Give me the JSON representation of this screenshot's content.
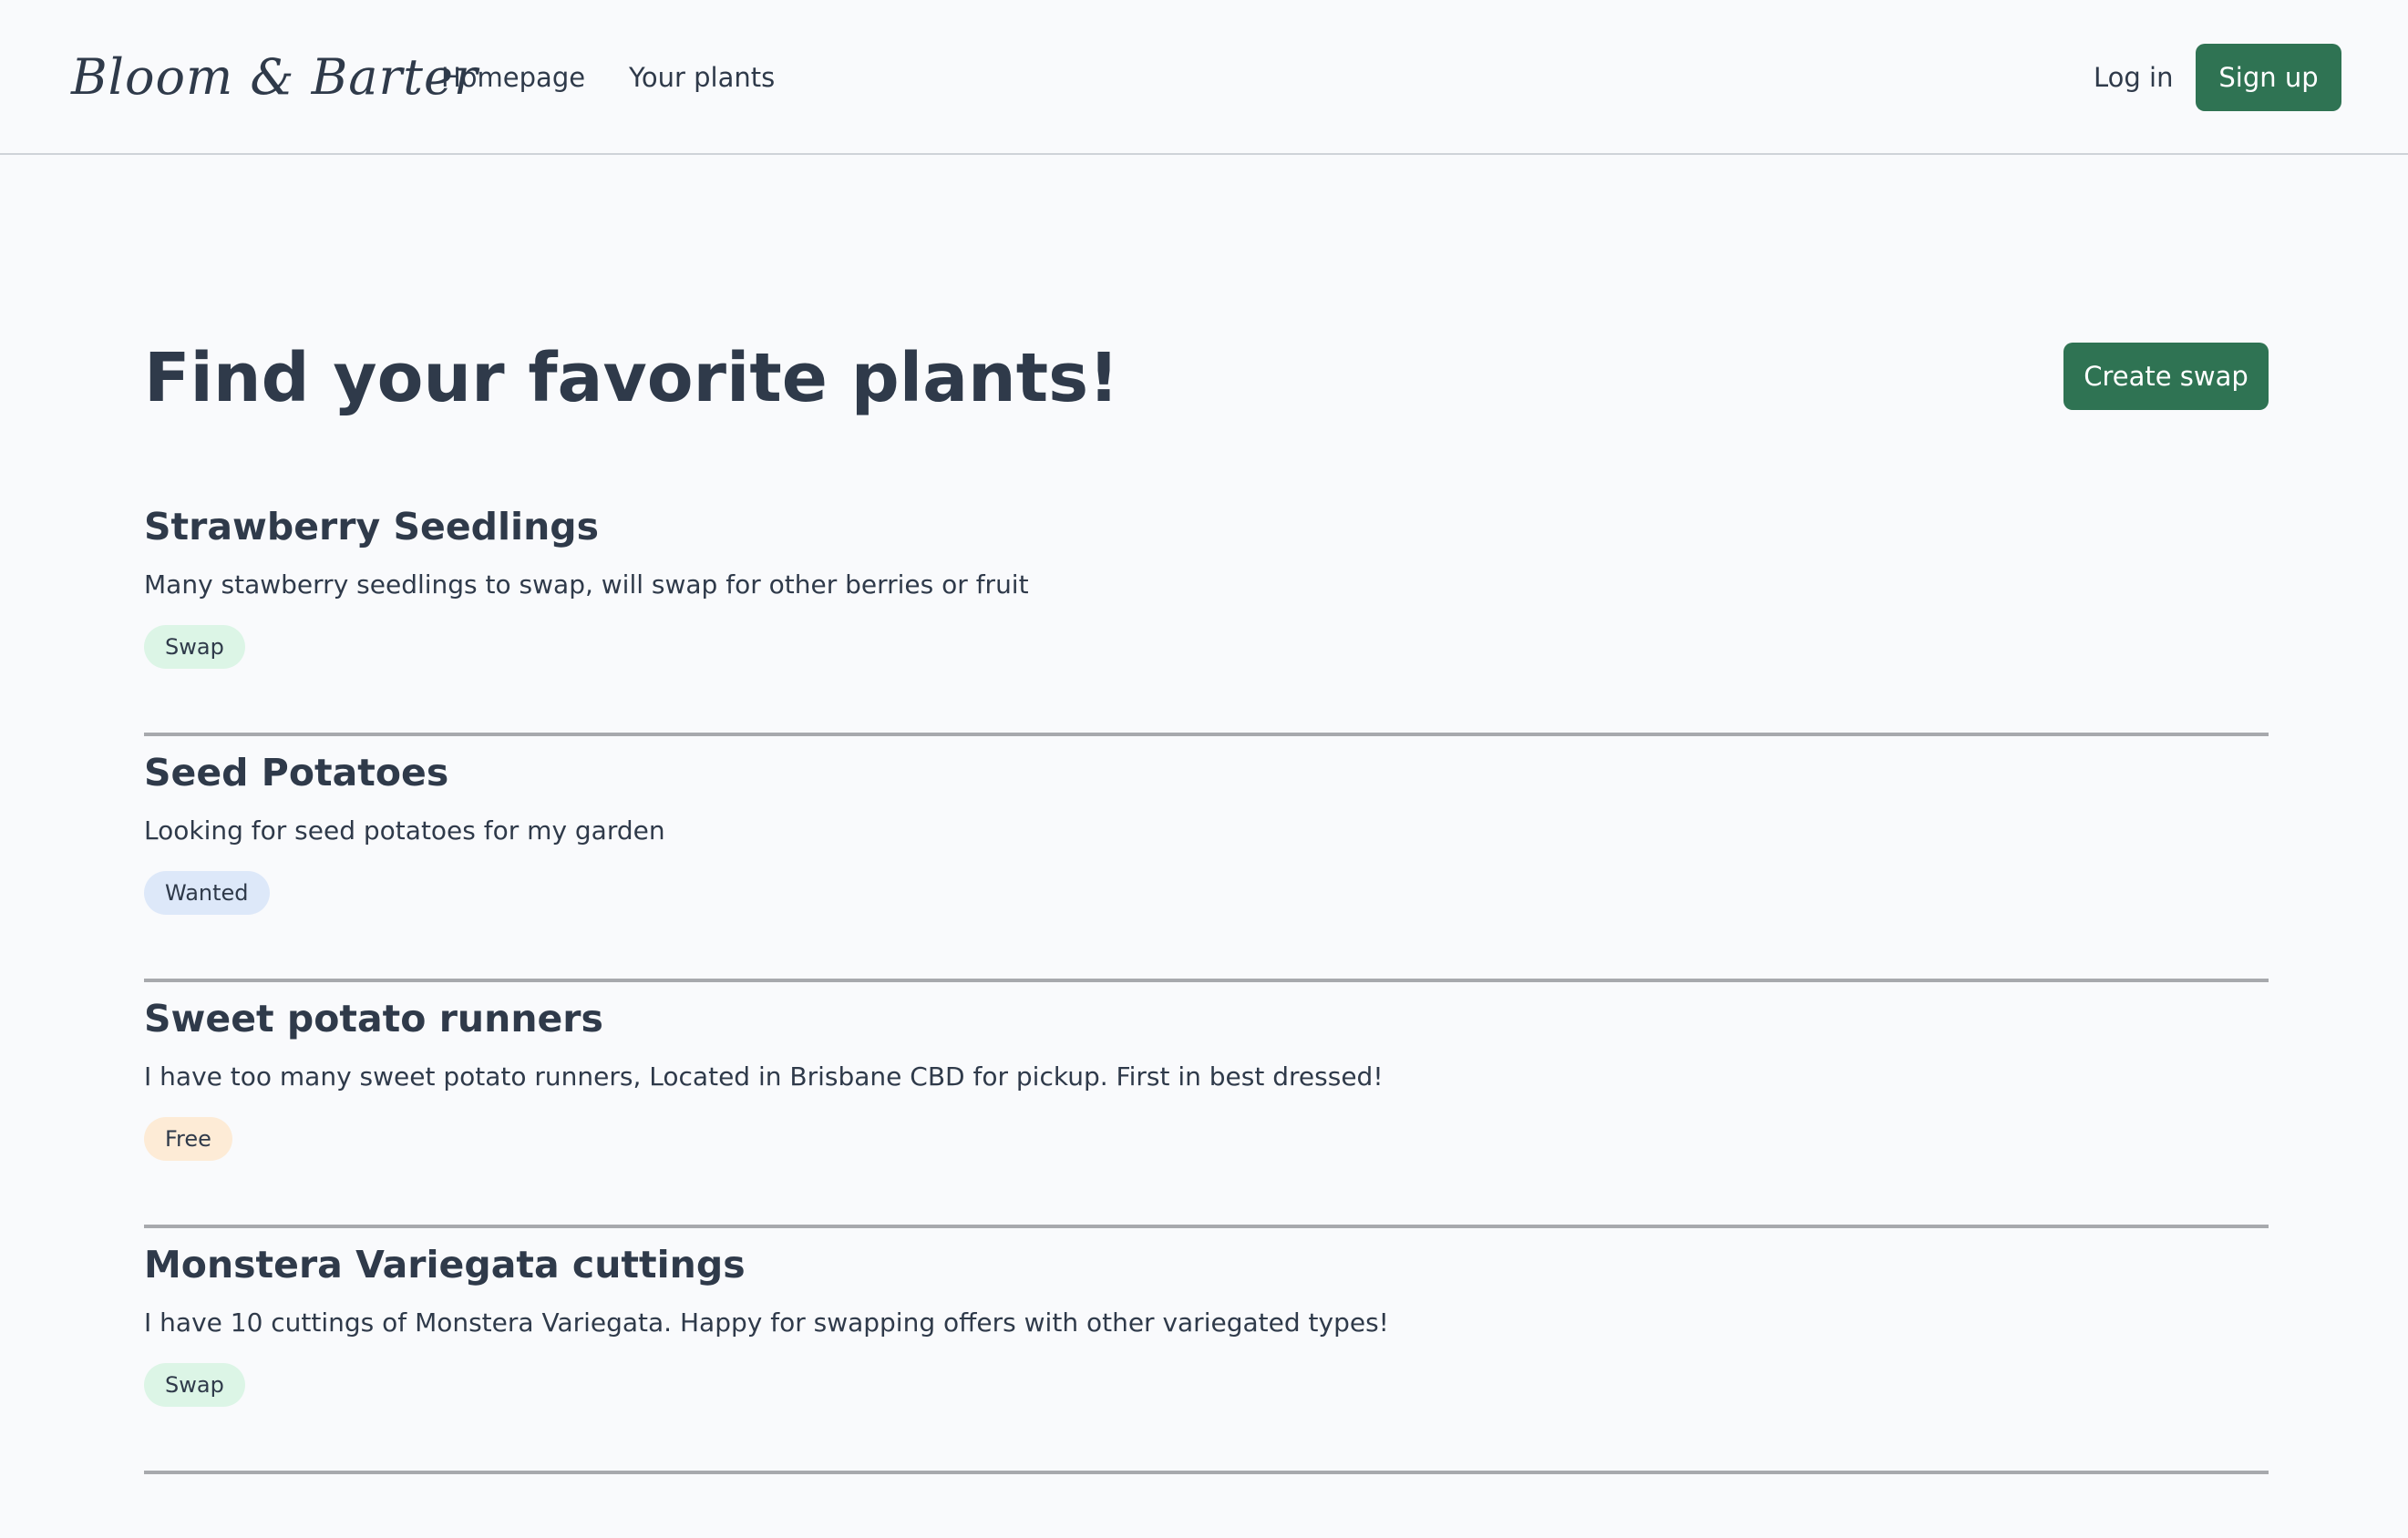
{
  "header": {
    "logo": "Bloom & Barter",
    "nav": [
      {
        "label": "Homepage"
      },
      {
        "label": "Your plants"
      }
    ],
    "login_label": "Log in",
    "signup_label": "Sign up"
  },
  "main": {
    "title": "Find your favorite plants!",
    "create_label": "Create swap",
    "listings": [
      {
        "title": "Strawberry Seedlings",
        "description": "Many stawberry seedlings to swap, will swap for other berries or fruit",
        "tag": "Swap"
      },
      {
        "title": "Seed Potatoes",
        "description": "Looking for seed potatoes for my garden",
        "tag": "Wanted"
      },
      {
        "title": "Sweet potato runners",
        "description": "I have too many sweet potato runners, Located in Brisbane CBD for pickup. First in best dressed!",
        "tag": "Free"
      },
      {
        "title": "Monstera Variegata cuttings",
        "description": "I have 10 cuttings of Monstera Variegata. Happy for swapping offers with other variegated types!",
        "tag": "Swap"
      }
    ]
  },
  "colors": {
    "accent": "#2f7353",
    "text": "#2f3a4a",
    "background": "#f9fafc",
    "tag_swap": "#dcf5e6",
    "tag_wanted": "#dde8f9",
    "tag_free": "#fdebd6"
  }
}
